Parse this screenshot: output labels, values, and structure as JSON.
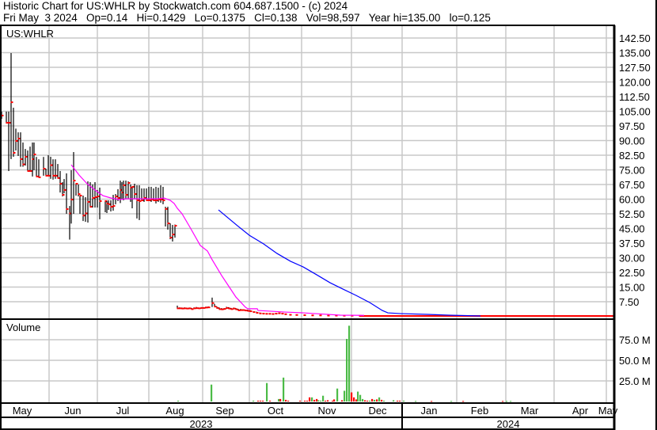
{
  "header": {
    "line1": "Historic Chart for US:WHLR by Stockwatch.com 604.687.1500 - (c) 2024",
    "line2": "Fri May  3 2024   Op=0.14   Hi=0.1429   Lo=0.1375   Cl=0.138   Vol=98,597   Year hi=135.00   lo=0.125"
  },
  "chart_data": {
    "type": "ohlc",
    "symbol": "US:WHLR",
    "price_axis": {
      "ticks": [
        "142.50",
        "135.00",
        "127.50",
        "120.00",
        "112.50",
        "105.00",
        "97.50",
        "90.00",
        "82.50",
        "75.00",
        "67.50",
        "60.00",
        "52.50",
        "45.00",
        "37.50",
        "30.00",
        "22.50",
        "15.00",
        "7.50"
      ],
      "ylim": [
        0,
        146
      ]
    },
    "volume_axis": {
      "label": "Volume",
      "ticks": [
        "75.0 M",
        "50.0 M",
        "25.0 M"
      ],
      "ylim_millions": [
        0,
        95
      ]
    },
    "x_axis": {
      "unit": "trading-day index",
      "xlim": [
        0,
        388
      ],
      "months": [
        {
          "label": "May",
          "pos": 14
        },
        {
          "label": "Jun",
          "pos": 46
        },
        {
          "label": "Jul",
          "pos": 77.5
        },
        {
          "label": "Aug",
          "pos": 110.5
        },
        {
          "label": "Sep",
          "pos": 142
        },
        {
          "label": "Oct",
          "pos": 174
        },
        {
          "label": "Nov",
          "pos": 206.5
        },
        {
          "label": "Dec",
          "pos": 238.5
        },
        {
          "label": "Jan",
          "pos": 271
        },
        {
          "label": "Feb",
          "pos": 303
        },
        {
          "label": "Mar",
          "pos": 334.5
        },
        {
          "label": "Apr",
          "pos": 366.5
        },
        {
          "label": "May",
          "pos": 384
        }
      ],
      "gridlines": [
        31,
        61.5,
        94,
        128,
        157.5,
        190.5,
        222,
        254,
        288.5,
        319.5,
        350,
        383
      ],
      "years": [
        {
          "label": "2023",
          "from": 0,
          "to": 254
        },
        {
          "label": "2024",
          "from": 254,
          "to": 388
        }
      ]
    },
    "bars_hi_lo_close": [
      [
        1,
        104.8,
        101.1,
        102.8
      ],
      [
        4,
        104.8,
        98.7,
        99.1
      ],
      [
        5.5,
        104.8,
        74.4,
        99.1
      ],
      [
        7,
        134.8,
        80.5,
        109.6
      ],
      [
        8.5,
        106.8,
        81.7,
        83.7
      ],
      [
        10,
        96.1,
        84.9,
        89.8
      ],
      [
        11.5,
        94.2,
        82.1,
        91.0
      ],
      [
        13,
        94.2,
        76.6,
        80.5
      ],
      [
        14.5,
        89.0,
        76.6,
        77.8
      ],
      [
        16,
        85.7,
        77.2,
        81.7
      ],
      [
        17.5,
        84.9,
        74.4,
        74.4
      ],
      [
        19,
        86.9,
        74.4,
        74.4
      ],
      [
        20.5,
        89.0,
        71.6,
        80.5
      ],
      [
        21.5,
        89.0,
        74.8,
        82.9
      ],
      [
        23,
        81.6,
        71.6,
        71.6
      ],
      [
        24.5,
        80.4,
        71.6,
        71.2
      ],
      [
        27.5,
        81.6,
        72.0,
        75.6
      ],
      [
        29,
        75.6,
        72.0,
        72.0
      ],
      [
        30.5,
        82.5,
        72.0,
        72.0
      ],
      [
        32,
        81.7,
        70.4,
        77.4
      ],
      [
        33.5,
        80.4,
        70.0,
        72.0
      ],
      [
        35,
        80.4,
        70.4,
        72.0
      ],
      [
        36.5,
        78.0,
        70.8,
        70.8
      ],
      [
        38,
        74.4,
        63.4,
        67.9
      ],
      [
        39.5,
        68.7,
        61.4,
        62.2
      ],
      [
        40.5,
        70.3,
        63.0,
        64.7
      ],
      [
        42,
        73.2,
        52.5,
        54.9
      ],
      [
        44,
        56.5,
        39.3,
        52.7
      ],
      [
        45,
        74.8,
        47.5,
        59.8
      ],
      [
        46.5,
        84.1,
        52.5,
        69.5
      ],
      [
        48,
        68.0,
        61.8,
        67.9
      ],
      [
        49.5,
        67.5,
        61.4,
        62.6
      ],
      [
        50.5,
        61.8,
        52.5,
        61.8
      ],
      [
        52.5,
        61.8,
        48.8,
        51.6
      ],
      [
        54,
        61.0,
        48.4,
        52.7
      ],
      [
        55.5,
        69.1,
        48.0,
        58.6
      ],
      [
        57,
        68.7,
        55.7,
        56.1
      ],
      [
        58.5,
        67.5,
        55.7,
        60.6
      ],
      [
        60,
        68.7,
        55.7,
        61.0
      ],
      [
        61.5,
        64.7,
        55.7,
        61.4
      ],
      [
        63,
        65.9,
        49.7,
        59.0
      ],
      [
        66.5,
        59.4,
        53.3,
        59.0
      ],
      [
        67.5,
        59.0,
        52.9,
        57.8
      ],
      [
        68.5,
        59.4,
        54.5,
        57.4
      ],
      [
        70,
        59.4,
        53.7,
        56.1
      ],
      [
        71.5,
        62.2,
        54.1,
        56.5
      ],
      [
        73,
        62.6,
        57.4,
        61.4
      ],
      [
        74.5,
        65.1,
        59.0,
        60.6
      ],
      [
        76,
        69.5,
        58.0,
        64.7
      ],
      [
        77,
        68.7,
        59.8,
        63.4
      ],
      [
        78,
        69.5,
        59.4,
        67.1
      ],
      [
        79.5,
        69.5,
        60.2,
        62.2
      ],
      [
        81,
        69.1,
        60.2,
        68.3
      ],
      [
        82.5,
        67.5,
        58.6,
        65.9
      ],
      [
        83.5,
        66.3,
        55.3,
        66.3
      ],
      [
        85,
        67.9,
        60.2,
        62.6
      ],
      [
        86.5,
        67.1,
        50.1,
        59.4
      ],
      [
        88,
        67.1,
        49.3,
        59.0
      ],
      [
        89.5,
        65.5,
        59.4,
        59.4
      ],
      [
        91,
        65.5,
        58.6,
        60.6
      ],
      [
        92.5,
        65.5,
        59.4,
        59.4
      ],
      [
        94,
        66.3,
        59.4,
        59.4
      ],
      [
        95.5,
        66.3,
        58.6,
        59.8
      ],
      [
        97,
        65.5,
        59.0,
        59.4
      ],
      [
        98.5,
        66.3,
        57.8,
        59.4
      ],
      [
        100,
        65.9,
        58.6,
        59.8
      ],
      [
        101.5,
        67.1,
        58.2,
        59.8
      ],
      [
        103,
        66.3,
        57.4,
        59.4
      ],
      [
        104.5,
        56.1,
        46.0,
        55.0
      ],
      [
        106,
        56.1,
        44.4,
        47.6
      ],
      [
        107.5,
        47.6,
        39.5,
        40.3
      ],
      [
        109,
        46.8,
        38.3,
        41.9
      ],
      [
        110.5,
        47.0,
        40.3,
        46.4
      ],
      [
        112,
        5.5,
        3.8,
        4.1
      ],
      [
        113.5,
        4.6,
        3.8,
        4.1
      ],
      [
        115,
        4.5,
        3.8,
        4.0
      ],
      [
        116.5,
        4.6,
        3.9,
        4.1
      ],
      [
        118,
        4.4,
        3.8,
        4.0
      ],
      [
        119.5,
        4.5,
        3.8,
        4.1
      ],
      [
        121,
        4.3,
        3.6,
        3.7
      ],
      [
        122.5,
        4.6,
        3.8,
        4.1
      ],
      [
        124,
        4.8,
        3.9,
        4.2
      ],
      [
        125.5,
        4.5,
        3.9,
        4.1
      ],
      [
        127,
        4.7,
        3.9,
        4.3
      ],
      [
        128.5,
        4.6,
        4.0,
        4.3
      ],
      [
        130,
        5.0,
        4.3,
        4.5
      ],
      [
        131.5,
        5.1,
        4.3,
        4.6
      ],
      [
        134,
        9.6,
        4.8,
        6.8
      ],
      [
        135.5,
        6.4,
        4.9,
        5.0
      ],
      [
        137,
        5.0,
        3.9,
        4.3
      ],
      [
        138.5,
        4.5,
        3.4,
        3.7
      ],
      [
        140,
        4.2,
        3.3,
        3.6
      ],
      [
        141.5,
        4.2,
        3.4,
        3.8
      ],
      [
        143,
        4.9,
        3.8,
        4.3
      ],
      [
        144.5,
        4.7,
        3.8,
        4.0
      ],
      [
        146,
        4.3,
        3.5,
        3.7
      ],
      [
        147.5,
        4.5,
        3.6,
        4.0
      ],
      [
        149,
        4.2,
        3.3,
        3.6
      ],
      [
        150.5,
        3.8,
        3.0,
        3.1
      ],
      [
        152,
        3.8,
        3.0,
        3.2
      ],
      [
        153.5,
        3.6,
        2.9,
        3.2
      ],
      [
        155,
        3.4,
        2.7,
        3.0
      ],
      [
        156.5,
        3.4,
        2.6,
        2.8
      ],
      [
        158,
        3.2,
        2.4,
        2.6
      ],
      [
        160,
        2.6,
        2.0,
        2.2
      ],
      [
        162,
        2.4,
        1.6,
        1.8
      ],
      [
        164,
        2.0,
        1.4,
        1.5
      ],
      [
        166,
        1.8,
        1.3,
        1.4
      ],
      [
        168,
        1.6,
        1.2,
        1.3
      ],
      [
        170,
        1.6,
        1.2,
        1.3
      ],
      [
        172,
        1.5,
        1.1,
        1.2
      ],
      [
        174,
        1.8,
        1.1,
        1.4
      ],
      [
        176,
        1.9,
        1.2,
        1.6
      ],
      [
        178,
        1.7,
        1.2,
        1.4
      ],
      [
        180,
        1.4,
        1.0,
        1.1
      ],
      [
        183,
        1.1,
        0.7,
        0.8
      ],
      [
        187,
        0.9,
        0.6,
        0.7
      ],
      [
        192,
        0.8,
        0.5,
        0.6
      ],
      [
        197,
        0.7,
        0.4,
        0.5
      ],
      [
        202,
        0.6,
        0.4,
        0.5
      ],
      [
        207,
        0.6,
        0.3,
        0.4
      ],
      [
        212,
        0.5,
        0.3,
        0.4
      ],
      [
        217,
        0.5,
        0.3,
        0.35
      ],
      [
        222,
        0.45,
        0.3,
        0.35
      ],
      [
        227,
        0.45,
        0.25,
        0.3
      ]
    ],
    "close_tail": {
      "from": 227,
      "to": 388,
      "value": 0.2
    },
    "series": [
      {
        "name": "short moving average",
        "color": "#ff00ff",
        "points": [
          [
            45,
            77.6
          ],
          [
            50,
            72.3
          ],
          [
            55,
            67.9
          ],
          [
            60,
            64.7
          ],
          [
            65,
            61.8
          ],
          [
            70,
            60.6
          ],
          [
            75,
            59.8
          ],
          [
            80,
            60.2
          ],
          [
            90,
            60.2
          ],
          [
            100,
            60.2
          ],
          [
            103.5,
            60.6
          ],
          [
            107.5,
            59.4
          ],
          [
            110,
            57.8
          ],
          [
            112,
            55.3
          ],
          [
            115,
            52.5
          ],
          [
            120,
            45.6
          ],
          [
            126.5,
            36.3
          ],
          [
            131,
            33.5
          ],
          [
            134,
            29.0
          ],
          [
            140,
            20.9
          ],
          [
            145,
            14.8
          ],
          [
            149,
            9.9
          ],
          [
            155,
            4.7
          ],
          [
            156.5,
            3.9
          ],
          [
            162.5,
            3.9
          ],
          [
            163,
            3.0
          ],
          [
            180,
            2.2
          ],
          [
            191.5,
            1.8
          ],
          [
            215,
            0.6
          ],
          [
            230,
            0.5
          ]
        ]
      },
      {
        "name": "long moving average",
        "color": "#0000ff",
        "points": [
          [
            138,
            54.5
          ],
          [
            150,
            46.4
          ],
          [
            157.5,
            41.5
          ],
          [
            166.5,
            37.1
          ],
          [
            175,
            32.2
          ],
          [
            183.5,
            28.2
          ],
          [
            191.5,
            25.3
          ],
          [
            200,
            21.3
          ],
          [
            208.5,
            17.2
          ],
          [
            216.5,
            14.0
          ],
          [
            225,
            10.7
          ],
          [
            233.5,
            7.1
          ],
          [
            241.5,
            3.0
          ],
          [
            245,
            1.8
          ],
          [
            253.5,
            1.4
          ],
          [
            270,
            1.0
          ],
          [
            283.5,
            0.6
          ],
          [
            303.5,
            0.2
          ]
        ]
      }
    ],
    "volume_millions": [
      [
        112.5,
        1,
        "up"
      ],
      [
        133.5,
        20.5,
        "up"
      ],
      [
        160,
        1,
        "up"
      ],
      [
        163,
        1,
        "down"
      ],
      [
        164.5,
        1,
        "down"
      ],
      [
        166,
        1,
        "down"
      ],
      [
        168.5,
        22.4,
        "up"
      ],
      [
        170.5,
        1,
        "down"
      ],
      [
        176,
        3,
        "up"
      ],
      [
        177,
        3,
        "down"
      ],
      [
        179,
        29,
        "up"
      ],
      [
        180.5,
        2,
        "down"
      ],
      [
        182,
        1,
        "down"
      ],
      [
        189.5,
        1,
        "down"
      ],
      [
        192.5,
        1,
        "down"
      ],
      [
        194,
        1,
        "down"
      ],
      [
        195.5,
        5,
        "down"
      ],
      [
        197,
        5,
        "up"
      ],
      [
        198.5,
        2,
        "down"
      ],
      [
        200,
        3,
        "down"
      ],
      [
        201,
        1.5,
        "up"
      ],
      [
        202.5,
        1,
        "up"
      ],
      [
        204,
        7,
        "up"
      ],
      [
        205.5,
        1,
        "down"
      ],
      [
        207,
        1.5,
        "down"
      ],
      [
        210,
        1,
        "down"
      ],
      [
        211,
        2.5,
        "down"
      ],
      [
        213,
        15.7,
        "up"
      ],
      [
        216,
        1.5,
        "down"
      ],
      [
        217.5,
        13,
        "up"
      ],
      [
        219,
        76,
        "up"
      ],
      [
        220.5,
        92,
        "up"
      ],
      [
        222,
        11,
        "down"
      ],
      [
        223.5,
        5,
        "down"
      ],
      [
        225,
        2.5,
        "down"
      ],
      [
        226,
        12,
        "up"
      ],
      [
        227.5,
        8,
        "up"
      ],
      [
        229,
        3,
        "up"
      ],
      [
        230.5,
        1.5,
        "down"
      ],
      [
        232,
        1,
        "down"
      ],
      [
        233.5,
        1,
        "up"
      ],
      [
        235,
        3,
        "down"
      ],
      [
        236.5,
        2,
        "up"
      ],
      [
        238,
        2.5,
        "down"
      ],
      [
        239.5,
        5,
        "up"
      ],
      [
        241,
        2,
        "down"
      ],
      [
        242.5,
        1,
        "up"
      ],
      [
        248.5,
        1.5,
        "up"
      ],
      [
        251,
        1,
        "down"
      ],
      [
        252.5,
        1,
        "down"
      ],
      [
        255,
        1,
        "up"
      ],
      [
        262.5,
        0.6,
        "up"
      ],
      [
        272.5,
        0.6,
        "down"
      ],
      [
        285,
        0.6,
        "up"
      ],
      [
        292.5,
        0.6,
        "down"
      ],
      [
        317.5,
        0.6,
        "down"
      ],
      [
        320,
        0.6,
        "up"
      ],
      [
        322.5,
        0.6,
        "up"
      ]
    ],
    "colors": {
      "grid": "#c8c8c8",
      "close_mark": "#ff0000",
      "bar": "#000000",
      "volume_up": "#4cbb47",
      "volume_down": "#ff0000"
    }
  }
}
